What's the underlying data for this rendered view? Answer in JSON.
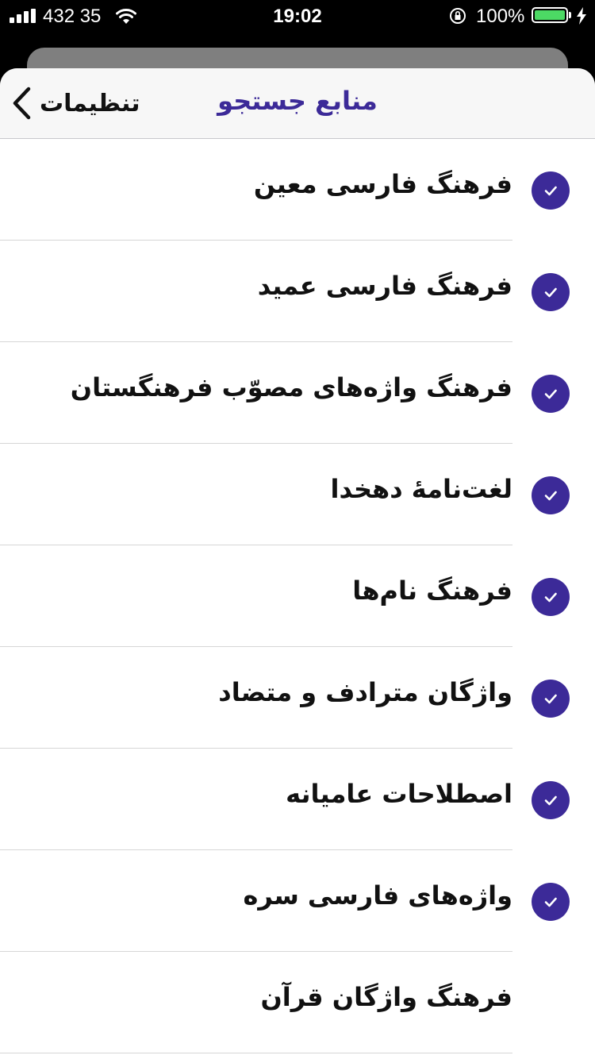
{
  "status_bar": {
    "carrier": "432 35",
    "time": "19:02",
    "battery_percent": "100%",
    "battery_level": 1.0,
    "icons": [
      "signal-icon",
      "wifi-icon",
      "orientation-lock-icon",
      "battery-icon",
      "charging-bolt-icon"
    ]
  },
  "colors": {
    "accent": "#3c2a98",
    "battery_green": "#4cd964",
    "divider": "#d6d6d6",
    "nav_background": "#f7f7f7"
  },
  "nav": {
    "back_label": "تنظیمات",
    "back_icon": "chevron-left-icon",
    "title": "منابع جستجو"
  },
  "sources": [
    {
      "label": "فرهنگ فارسی معین",
      "checked": true
    },
    {
      "label": "فرهنگ فارسی عمید",
      "checked": true
    },
    {
      "label": "فرهنگ واژه‌های مصوّب فرهنگستان",
      "checked": true
    },
    {
      "label": "لغت‌نامهٔ دهخدا",
      "checked": true
    },
    {
      "label": "فرهنگ نام‌ها",
      "checked": true
    },
    {
      "label": "واژگان مترادف و متضاد",
      "checked": true
    },
    {
      "label": "اصطلاحات عامیانه",
      "checked": true
    },
    {
      "label": "واژه‌های فارسی سره",
      "checked": true
    },
    {
      "label": "فرهنگ واژگان قرآن",
      "checked": false
    }
  ]
}
